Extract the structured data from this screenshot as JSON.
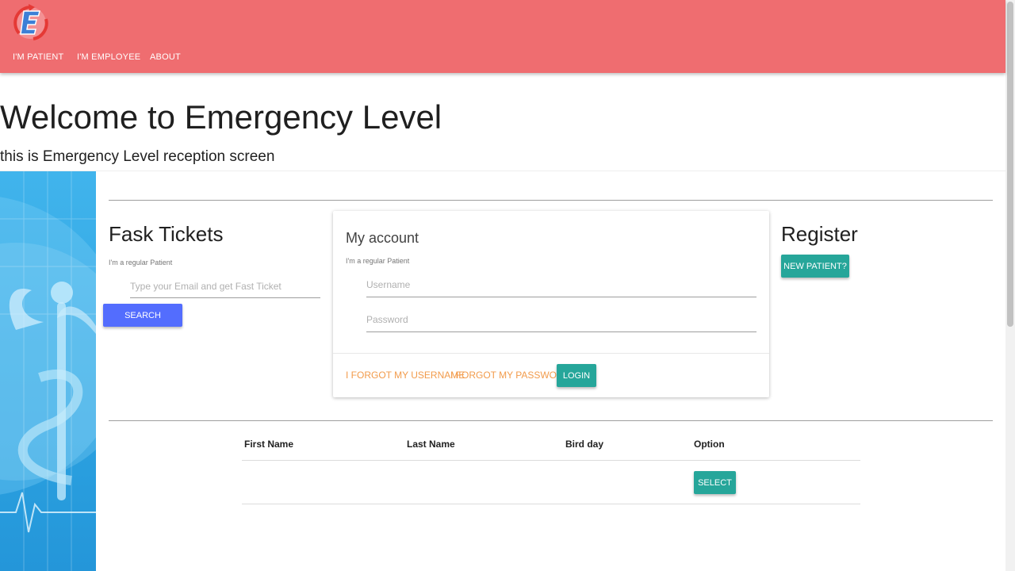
{
  "nav": {
    "logo_letter": "E",
    "links": [
      "I'M PATIENT",
      "I'M EMPLOYEE",
      "ABOUT"
    ]
  },
  "hero": {
    "title": "Welcome to Emergency Level",
    "subtitle": "this is Emergency Level reception screen"
  },
  "fast_ticket": {
    "title": "Fask Tickets",
    "hint": "I'm a regular Patient",
    "email_placeholder": "Type your Email and get Fast Ticket",
    "email_value": "",
    "search_label": "SEARCH"
  },
  "account": {
    "title": "My account",
    "hint": "I'm a regular Patient",
    "username_placeholder": "Username",
    "password_placeholder": "Password",
    "forgot_username": "I FORGOT MY USERNAME",
    "forgot_password": "I FORGOT MY PASSWORD",
    "login_label": "LOGIN"
  },
  "register": {
    "title": "Register",
    "new_patient_label": "NEW PATIENT?"
  },
  "table": {
    "headers": [
      "First Name",
      "Last Name",
      "Bird day",
      "Option"
    ],
    "rows": [
      {
        "first_name": "",
        "last_name": "",
        "birthday": "",
        "option_label": "SELECT"
      }
    ]
  },
  "colors": {
    "appbar": "#ef6d70",
    "search_button": "#536dfe",
    "teal_button": "#26a69a",
    "link": "#f29b4b",
    "banner": "#2da4e2"
  }
}
